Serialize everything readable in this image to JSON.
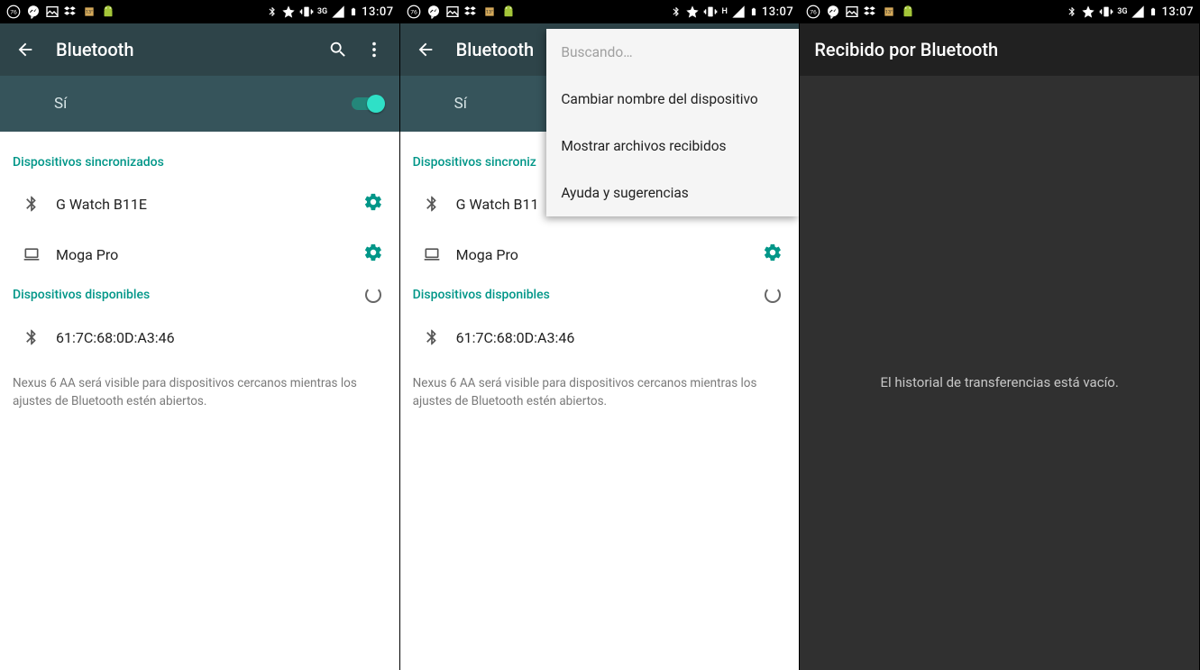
{
  "statusbar": {
    "battery_badge": "76",
    "time": "13:07",
    "signal_label_3g": "3G",
    "signal_label_h": "H"
  },
  "screen1": {
    "title": "Bluetooth",
    "switch_label": "Sí",
    "sections": {
      "paired_title": "Dispositivos sincronizados",
      "available_title": "Dispositivos disponibles"
    },
    "paired": [
      {
        "name": "G Watch B11E",
        "icon": "bluetooth"
      },
      {
        "name": "Moga Pro",
        "icon": "laptop"
      }
    ],
    "available": [
      {
        "name": "61:7C:68:0D:A3:46",
        "icon": "bluetooth"
      }
    ],
    "footnote": "Nexus 6 AA será visible para dispositivos cercanos mientras los ajustes de Bluetooth estén abiertos."
  },
  "screen2": {
    "title": "Bluetooth",
    "switch_label": "Sí",
    "sections": {
      "paired_title": "Dispositivos sincroniz",
      "available_title": "Dispositivos disponibles"
    },
    "paired": [
      {
        "name": "G Watch B11",
        "icon": "bluetooth"
      },
      {
        "name": "Moga Pro",
        "icon": "laptop"
      }
    ],
    "available": [
      {
        "name": "61:7C:68:0D:A3:46",
        "icon": "bluetooth"
      }
    ],
    "footnote": "Nexus 6 AA será visible para dispositivos cercanos mientras los ajustes de Bluetooth estén abiertos.",
    "menu": [
      {
        "label": "Buscando…",
        "disabled": true
      },
      {
        "label": "Cambiar nombre del dispositivo",
        "disabled": false
      },
      {
        "label": "Mostrar archivos recibidos",
        "disabled": false
      },
      {
        "label": "Ayuda y sugerencias",
        "disabled": false
      }
    ]
  },
  "screen3": {
    "title": "Recibido por Bluetooth",
    "empty_text": "El historial de transferencias está vacío."
  }
}
